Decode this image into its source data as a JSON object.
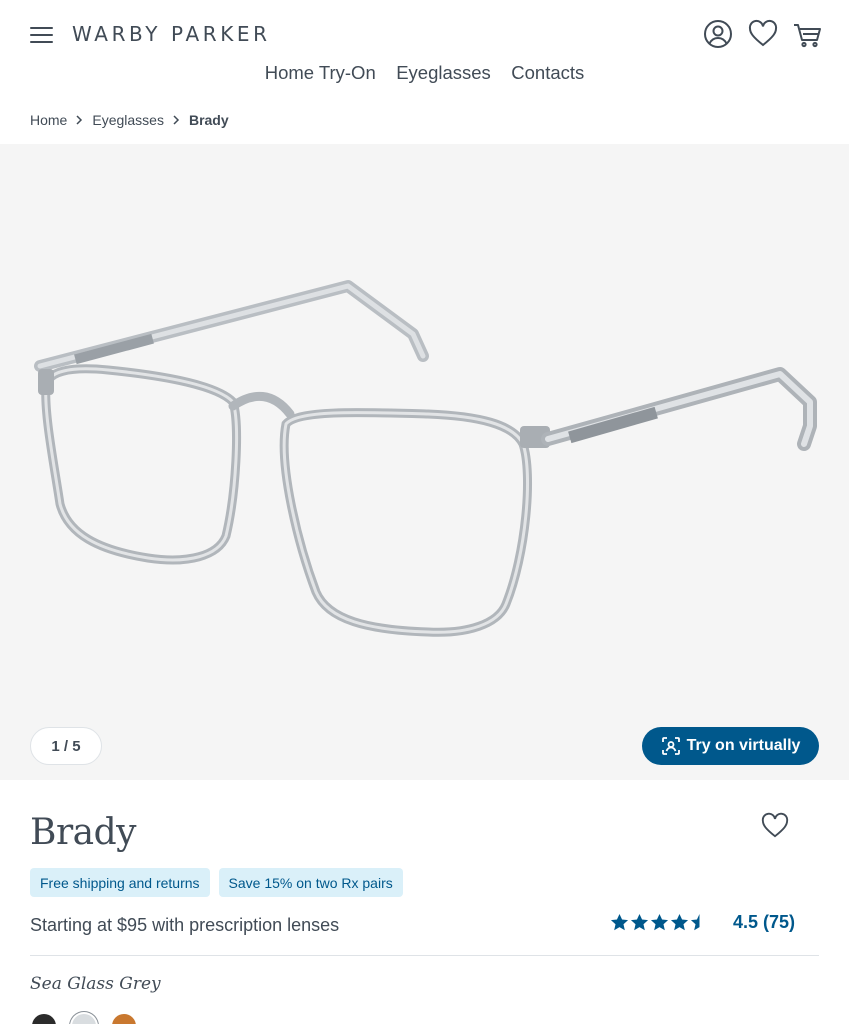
{
  "header": {
    "logo": "WARBY PARKER",
    "nav": [
      "Home Try-On",
      "Eyeglasses",
      "Contacts"
    ]
  },
  "breadcrumb": [
    "Home",
    "Eyeglasses",
    "Brady"
  ],
  "gallery": {
    "counter": "1 / 5",
    "try_on_label": "Try on virtually"
  },
  "product": {
    "name": "Brady",
    "badges": [
      "Free shipping and returns",
      "Save 15% on two Rx pairs"
    ],
    "price_text": "Starting at $95 with prescription lenses",
    "rating": 4.5,
    "rating_text": "4.5 (75)",
    "color_name": "Sea Glass Grey",
    "swatches": [
      "#2b2b2b",
      "#d9dde0",
      "#c9782f"
    ]
  },
  "colors": {
    "text": "#414b56",
    "accent": "#00588c",
    "badge_bg": "#daf0f9",
    "gallery_bg": "#f5f5f5"
  }
}
